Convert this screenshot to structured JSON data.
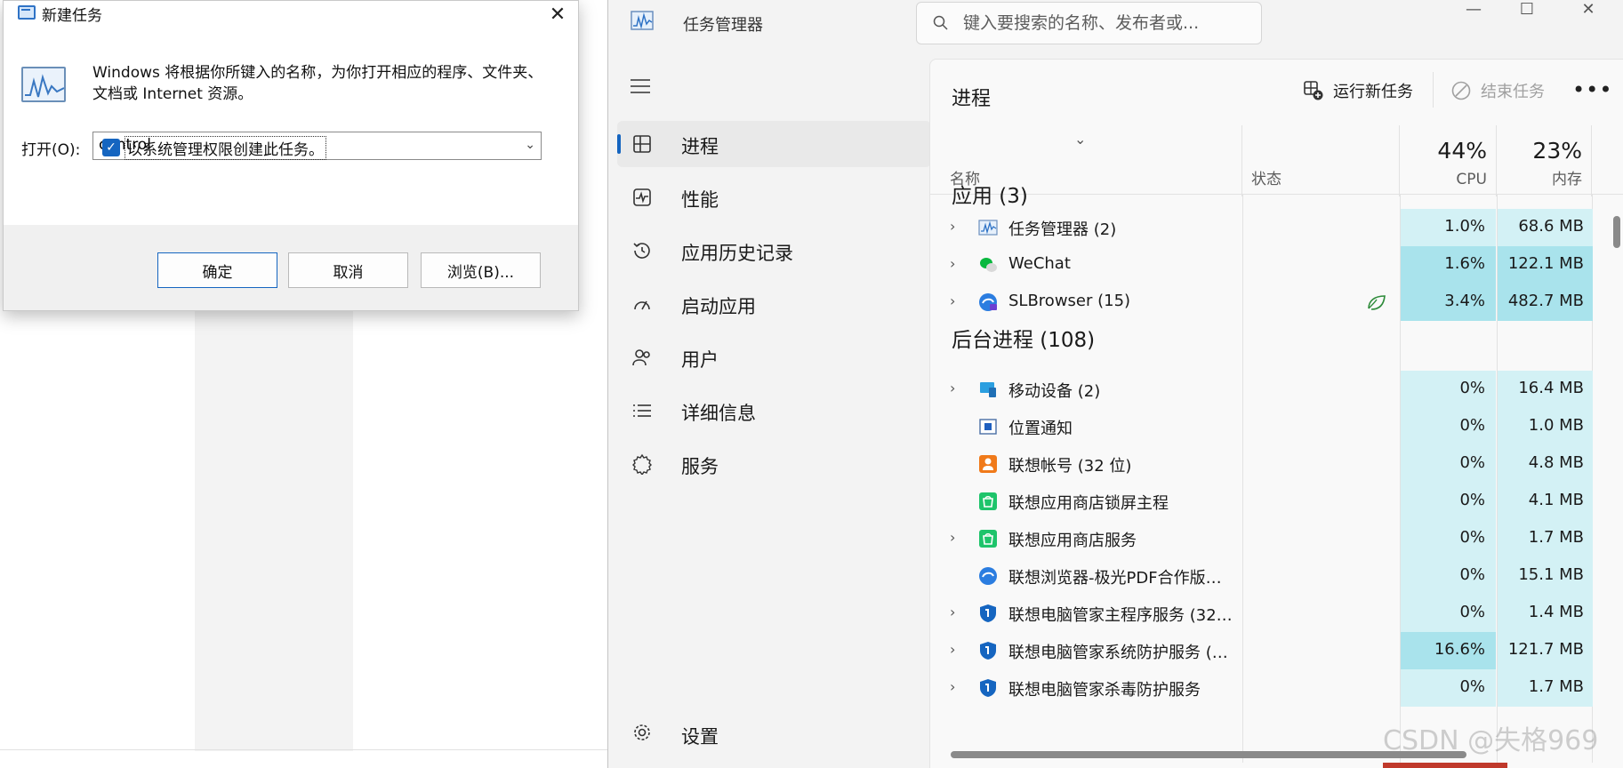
{
  "run_dialog": {
    "title": "新建任务",
    "close": "✕",
    "description": "Windows 将根据你所键入的名称，为你打开相应的程序、文件夹、文档或 Internet 资源。",
    "open_label": "打开(O):",
    "open_value": "control",
    "admin_checkbox_label": "以系统管理权限创建此任务。",
    "admin_checked": true,
    "ok_label": "确定",
    "cancel_label": "取消",
    "browse_label": "浏览(B)..."
  },
  "task_manager": {
    "title": "任务管理器",
    "search_placeholder": "键入要搜索的名称、发布者或...",
    "window_controls": {
      "minimize": "—",
      "maximize": "☐",
      "close": "✕"
    },
    "nav": [
      {
        "label": "进程",
        "icon": "processes-icon",
        "active": true
      },
      {
        "label": "性能",
        "icon": "performance-icon"
      },
      {
        "label": "应用历史记录",
        "icon": "app-history-icon"
      },
      {
        "label": "启动应用",
        "icon": "startup-apps-icon"
      },
      {
        "label": "用户",
        "icon": "users-icon"
      },
      {
        "label": "详细信息",
        "icon": "details-icon"
      },
      {
        "label": "服务",
        "icon": "services-icon"
      }
    ],
    "settings_label": "设置",
    "main": {
      "title": "进程",
      "run_new_task": "运行新任务",
      "end_task": "结束任务",
      "more": "•••",
      "columns": {
        "name": "名称",
        "status": "状态",
        "cpu_label": "CPU",
        "cpu_pct": "44%",
        "mem_label": "内存",
        "mem_pct": "23%"
      },
      "apps_title": "应用 (3)",
      "apps": [
        {
          "name": "任务管理器 (2)",
          "cpu": "1.0%",
          "mem": "68.6 MB",
          "expandable": true,
          "icon": "task-manager-icon"
        },
        {
          "name": "WeChat",
          "cpu": "1.6%",
          "mem": "122.1 MB",
          "expandable": true,
          "icon": "wechat-icon"
        },
        {
          "name": "SLBrowser (15)",
          "cpu": "3.4%",
          "mem": "482.7 MB",
          "expandable": true,
          "icon": "slbrowser-icon",
          "efficiency": true
        }
      ],
      "bg_title": "后台进程 (108)",
      "background": [
        {
          "name": "移动设备 (2)",
          "cpu": "0%",
          "mem": "16.4 MB",
          "expandable": true,
          "icon": "mobile-device-icon"
        },
        {
          "name": "位置通知",
          "cpu": "0%",
          "mem": "1.0 MB",
          "expandable": false,
          "icon": "location-notify-icon"
        },
        {
          "name": "联想帐号 (32 位)",
          "cpu": "0%",
          "mem": "4.8 MB",
          "expandable": false,
          "icon": "lenovo-account-icon"
        },
        {
          "name": "联想应用商店锁屏主程",
          "cpu": "0%",
          "mem": "4.1 MB",
          "expandable": false,
          "icon": "lenovo-store-icon"
        },
        {
          "name": "联想应用商店服务",
          "cpu": "0%",
          "mem": "1.7 MB",
          "expandable": true,
          "icon": "lenovo-store-icon"
        },
        {
          "name": "联想浏览器-极光PDF合作版阅...",
          "cpu": "0%",
          "mem": "15.1 MB",
          "expandable": false,
          "icon": "lenovo-browser-icon"
        },
        {
          "name": "联想电脑管家主程序服务 (32 ...",
          "cpu": "0%",
          "mem": "1.4 MB",
          "expandable": true,
          "icon": "lenovo-shield-icon"
        },
        {
          "name": "联想电脑管家系统防护服务 (3...",
          "cpu": "16.6%",
          "mem": "121.7 MB",
          "expandable": true,
          "icon": "lenovo-shield-icon",
          "highlight": true
        },
        {
          "name": "联想电脑管家杀毒防护服务",
          "cpu": "0%",
          "mem": "1.7 MB",
          "expandable": true,
          "icon": "lenovo-shield-icon"
        }
      ]
    }
  },
  "watermark": "CSDN @失格969",
  "colors": {
    "accent": "#1565c0",
    "cpu_bg": "#d3f1f5",
    "cpu_hi": "#a9e3ec"
  }
}
